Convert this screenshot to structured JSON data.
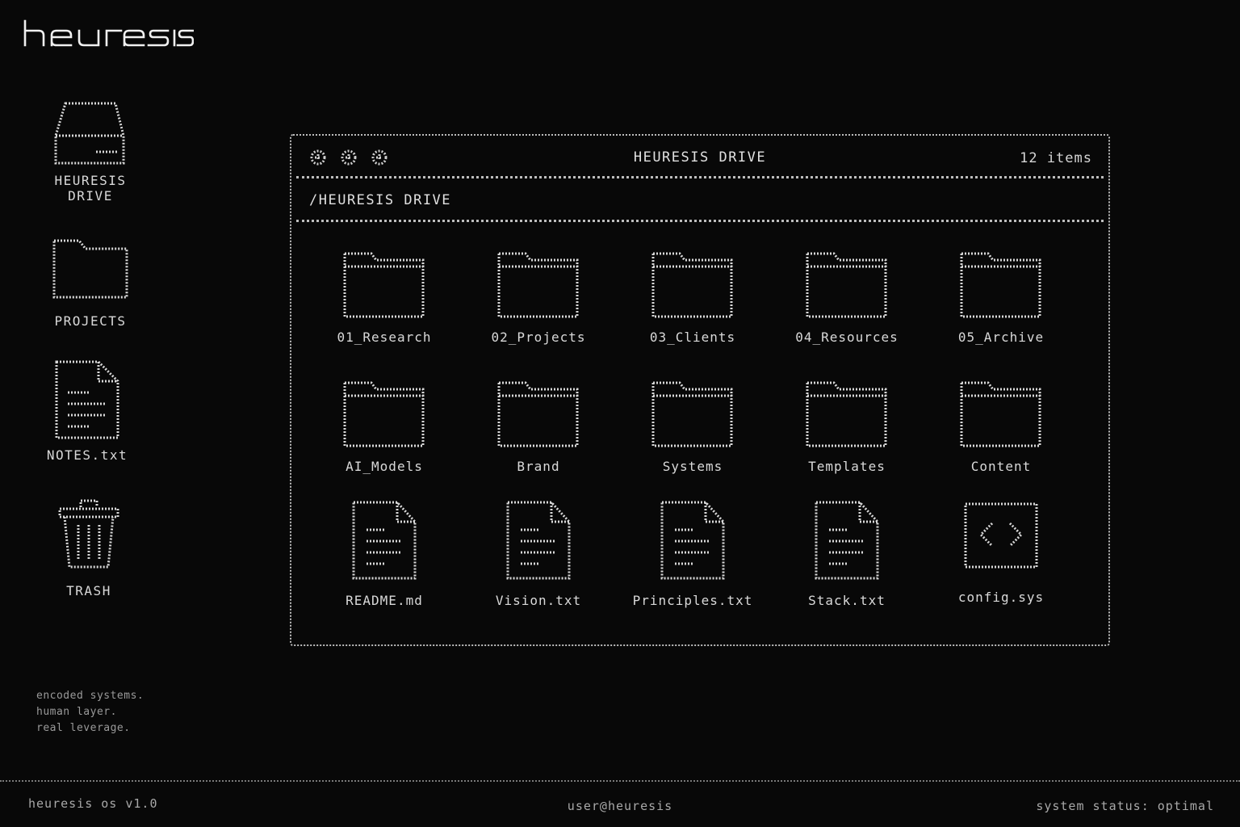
{
  "brand": {
    "logo_text": "heuresis"
  },
  "desktop": {
    "items": [
      {
        "label": "HEURESIS\nDRIVE",
        "icon": "drive-icon"
      },
      {
        "label": "PROJECTS",
        "icon": "folder-icon"
      },
      {
        "label": "NOTES.txt",
        "icon": "document-icon"
      },
      {
        "label": "TRASH",
        "icon": "trash-icon"
      }
    ]
  },
  "tagline": [
    "encoded systems.",
    "human layer.",
    "real leverage."
  ],
  "window": {
    "title": "HEURESIS DRIVE",
    "count": "12 items",
    "path": "/HEURESIS DRIVE",
    "items": [
      {
        "label": "01_Research",
        "icon": "folder-icon"
      },
      {
        "label": "02_Projects",
        "icon": "folder-icon"
      },
      {
        "label": "03_Clients",
        "icon": "folder-icon"
      },
      {
        "label": "04_Resources",
        "icon": "folder-icon"
      },
      {
        "label": "05_Archive",
        "icon": "folder-icon"
      },
      {
        "label": "AI_Models",
        "icon": "folder-icon"
      },
      {
        "label": "Brand",
        "icon": "folder-icon"
      },
      {
        "label": "Systems",
        "icon": "folder-icon"
      },
      {
        "label": "Templates",
        "icon": "folder-icon"
      },
      {
        "label": "Content",
        "icon": "folder-icon"
      },
      {
        "label": "README.md",
        "icon": "document-icon"
      },
      {
        "label": "Vision.txt",
        "icon": "document-icon"
      },
      {
        "label": "Principles.txt",
        "icon": "document-icon"
      },
      {
        "label": "Stack.txt",
        "icon": "document-icon"
      },
      {
        "label": "config.sys",
        "icon": "code-file-icon"
      }
    ]
  },
  "footer": {
    "left": "heuresis os v1.0",
    "center": "user@heuresis",
    "right": "system status: optimal"
  },
  "colors": {
    "background": "#080808",
    "foreground": "#e6e6e6",
    "dim": "#9a9a9a"
  }
}
